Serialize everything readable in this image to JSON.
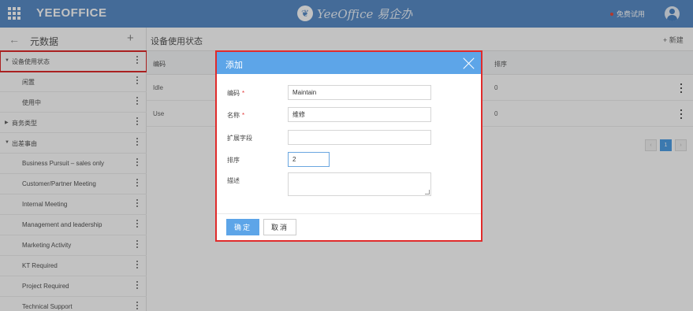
{
  "topbar": {
    "brand": "YEEOFFICE",
    "logo_text": "YeeOffice 易企办",
    "trial_label": "免费试用"
  },
  "sidebar": {
    "title": "元数据",
    "items": [
      {
        "label": "设备使用状态",
        "level": 0,
        "caret": "▼"
      },
      {
        "label": "闲置",
        "level": 1
      },
      {
        "label": "使用中",
        "level": 1
      },
      {
        "label": "商务类型",
        "level": 0,
        "caret": "▶"
      },
      {
        "label": "出差事由",
        "level": 0,
        "caret": "▼"
      },
      {
        "label": "Business Pursuit – sales only",
        "level": 1
      },
      {
        "label": "Customer/Partner Meeting",
        "level": 1
      },
      {
        "label": "Internal Meeting",
        "level": 1
      },
      {
        "label": "Management and leadership",
        "level": 1
      },
      {
        "label": "Marketing Activity",
        "level": 1
      },
      {
        "label": "KT Required",
        "level": 1
      },
      {
        "label": "Project Required",
        "level": 1
      },
      {
        "label": "Technical Support",
        "level": 1
      }
    ]
  },
  "main": {
    "title": "设备使用状态",
    "new_label": "+ 新建",
    "columns": {
      "code": "编码",
      "sort": "排序"
    },
    "rows": [
      {
        "code": "Idle",
        "sort": "0"
      },
      {
        "code": "Use",
        "sort": "0"
      }
    ],
    "pager": {
      "prev": "‹",
      "page": "1",
      "next": "›"
    }
  },
  "dialog": {
    "title": "添加",
    "fields": {
      "code": {
        "label": "编码",
        "value": "Maintain"
      },
      "name": {
        "label": "名称",
        "value": "维修"
      },
      "ext": {
        "label": "扩展字段",
        "value": ""
      },
      "sort": {
        "label": "排序",
        "value": "2"
      },
      "desc": {
        "label": "描述",
        "value": ""
      }
    },
    "required_mark": "*",
    "ok_label": "确定",
    "cancel_label": "取消"
  }
}
